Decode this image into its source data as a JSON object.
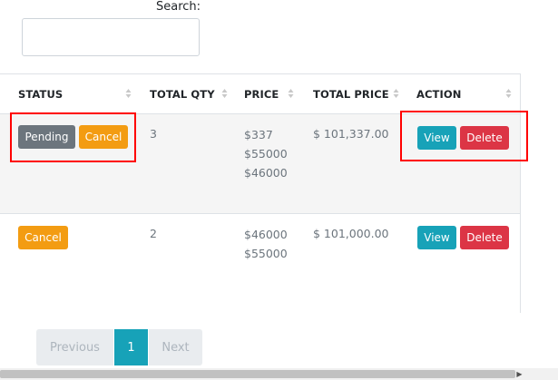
{
  "search": {
    "label": "Search:",
    "value": ""
  },
  "table": {
    "headers": [
      "STATUS",
      "TOTAL QTY",
      "PRICE",
      "TOTAL PRICE",
      "ACTION"
    ],
    "rows": [
      {
        "status_buttons": [
          "Pending",
          "Cancel"
        ],
        "total_qty": "3",
        "prices": [
          "$337",
          "$55000",
          "$46000"
        ],
        "total_price": "$ 101,337.00",
        "actions": [
          "View",
          "Delete"
        ]
      },
      {
        "status_buttons": [
          "Cancel"
        ],
        "total_qty": "2",
        "prices": [
          "$46000",
          "$55000"
        ],
        "total_price": "$ 101,000.00",
        "actions": [
          "View",
          "Delete"
        ]
      }
    ]
  },
  "pagination": {
    "prev": "Previous",
    "current": "1",
    "next": "Next"
  },
  "colors": {
    "pending": "#6c757d",
    "cancel": "#f39c12",
    "view": "#17a2b8",
    "delete": "#dc3545",
    "highlight": "#ff0000"
  }
}
